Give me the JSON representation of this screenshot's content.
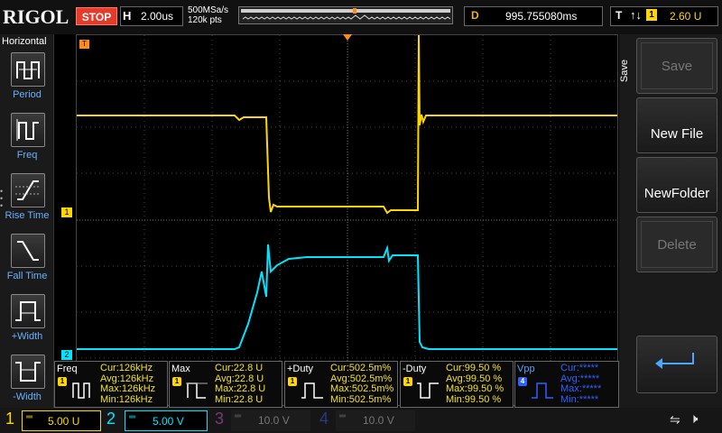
{
  "topbar": {
    "logo": "RIGOL",
    "run_status": "STOP",
    "timebase_label": "H",
    "timebase_value": "2.00us",
    "sample_rate": "500MSa/s",
    "memory_depth": "120k pts",
    "delay_label": "D",
    "delay_value": "995.755080ms",
    "trigger_label": "T",
    "trigger_edge": "↑↓",
    "trigger_channel": "1",
    "trigger_level": "2.60 U"
  },
  "left_menu": {
    "title": "Horizontal",
    "items": [
      {
        "label": "Period",
        "icon": "period-icon"
      },
      {
        "label": "Freq",
        "icon": "freq-icon"
      },
      {
        "label": "Rise Time",
        "icon": "rise-time-icon"
      },
      {
        "label": "Fall Time",
        "icon": "fall-time-icon"
      },
      {
        "label": "+Width",
        "icon": "pos-width-icon"
      },
      {
        "label": "-Width",
        "icon": "neg-width-icon"
      }
    ]
  },
  "right_menu": {
    "title": "Save",
    "buttons": [
      {
        "label": "Save",
        "enabled": false
      },
      {
        "label": "New File",
        "enabled": true
      },
      {
        "label": "NewFolder",
        "enabled": true
      },
      {
        "label": "Delete",
        "enabled": false
      }
    ],
    "enter_icon": "enter-arrow-icon"
  },
  "markers": {
    "trigger_pos": "T",
    "ch1_ref": "1",
    "ch2_ref": "2"
  },
  "measurements": [
    {
      "name": "Freq",
      "ch": "1",
      "cur": "Cur:126kHz",
      "avg": "Avg:126kHz",
      "max": "Max:126kHz",
      "min": "Min:126kHz"
    },
    {
      "name": "Max",
      "ch": "1",
      "cur": "Cur:22.8 U",
      "avg": "Avg:22.8 U",
      "max": "Max:22.8 U",
      "min": "Min:22.8 U"
    },
    {
      "name": "+Duty",
      "ch": "1",
      "cur": "Cur:502.5m%",
      "avg": "Avg:502.5m%",
      "max": "Max:502.5m%",
      "min": "Min:502.5m%"
    },
    {
      "name": "-Duty",
      "ch": "1",
      "cur": "Cur:99.50 %",
      "avg": "Avg:99.50 %",
      "max": "Max:99.50 %",
      "min": "Min:99.50 %"
    },
    {
      "name": "Vpp",
      "ch": "4",
      "cur": "Cur:*****",
      "avg": "Avg:*****",
      "max": "Max:*****",
      "min": "Min:*****"
    }
  ],
  "channels": [
    {
      "num": "1",
      "scale": "5.00 U",
      "color": "#ffd700",
      "active": true
    },
    {
      "num": "2",
      "scale": "5.00 V",
      "color": "#00e5ff",
      "active": true
    },
    {
      "num": "3",
      "scale": "10.0 V",
      "color": "#c040c0",
      "active": false
    },
    {
      "num": "4",
      "scale": "10.0 V",
      "color": "#3060ff",
      "active": false
    }
  ],
  "colors": {
    "ch1": "#ffd700",
    "ch2": "#00e5ff",
    "trigger": "#ff8c1a",
    "menu_accent": "#6ab0ff"
  },
  "status_icons": [
    "usb-icon",
    "speaker-muted-icon"
  ]
}
